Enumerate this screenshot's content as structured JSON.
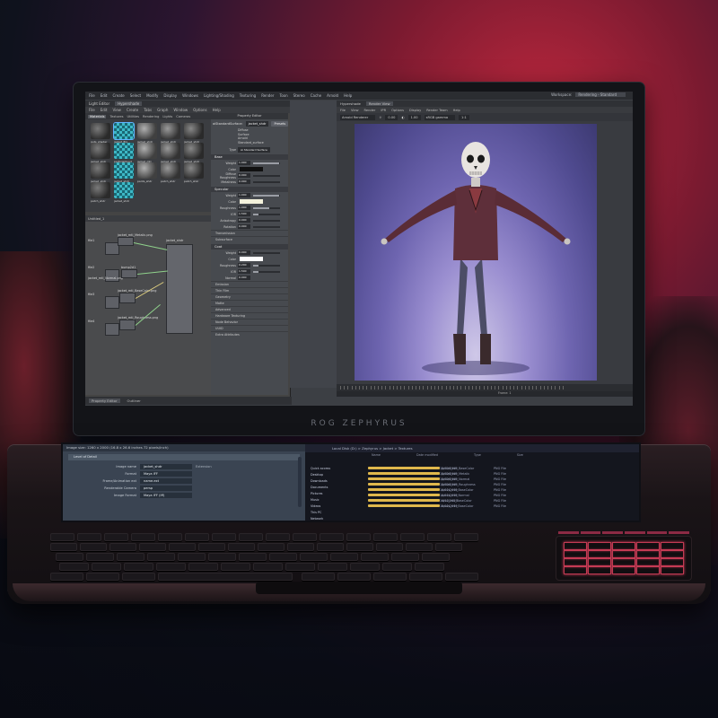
{
  "laptop": {
    "brand": "ROG ZEPHYRUS"
  },
  "maya": {
    "menu": [
      "File",
      "Edit",
      "Create",
      "Select",
      "Modify",
      "Display",
      "Windows",
      "Lighting/Shading",
      "Texturing",
      "Render",
      "Toon",
      "Stereo",
      "Cache",
      "Arnold",
      "Help"
    ],
    "workspace_label": "Workspace:",
    "workspace_value": "Rendering - Standard"
  },
  "hypershade": {
    "title_tabs": [
      "Light Editor",
      "Hypershade"
    ],
    "menu": [
      "File",
      "Edit",
      "View",
      "Create",
      "Tabs",
      "Graph",
      "Window",
      "Options",
      "Help"
    ],
    "browser_tabs": [
      "Materials",
      "Textures",
      "Utilities",
      "Rendering",
      "Lights",
      "Cameras"
    ],
    "swatches": [
      "guts_shader",
      "jacket_fbx",
      "jacket_shdr",
      "jacket_shdr",
      "jacket_shdr",
      "jacket_shdr",
      "particleCloud",
      "jacket_mtl",
      "jacket_shdr",
      "jacket_shdr",
      "jacket_shdr",
      "jacket_shdr",
      "pants_shdr",
      "patch_shdr",
      "patch_shdr",
      "patch_shdr",
      "jacket_shdr"
    ],
    "graph_tab": "Untitled_1",
    "node_labels": [
      "jacket_mtl_Metalic.png",
      "jacket_mtl_Normal.png",
      "bump2d1",
      "jacket_mtl_BaseColor.png",
      "jacket_mtl_Roughness.png",
      "jacket_shdr",
      "file1",
      "file2",
      "file3",
      "file4"
    ],
    "bottom_tabs": [
      "Property Editor",
      "Outliner"
    ]
  },
  "attribute_editor": {
    "title": "Property Editor",
    "node_type": "aiStandardSurface:",
    "node_name": "jacket_shdr",
    "presets": "Presets",
    "shader_list": [
      "Diffuse",
      "Surface",
      "Arnold",
      "Standard_surface"
    ],
    "type_label": "Type",
    "type_value": "Ai Standard Surface",
    "sections": [
      {
        "name": "Base",
        "rows": [
          {
            "label": "Weight",
            "value": "1.000",
            "fill": 0.95
          },
          {
            "label": "Color",
            "chip": "#111111"
          },
          {
            "label": "Diffuse Roughness",
            "value": "0.000",
            "fill": 0.0
          },
          {
            "label": "Metalness",
            "value": "0.000",
            "fill": 0.0
          }
        ]
      },
      {
        "name": "Specular",
        "rows": [
          {
            "label": "Weight",
            "value": "1.000",
            "fill": 0.95
          },
          {
            "label": "Color",
            "chip": "#f4f2dc"
          },
          {
            "label": "Roughness",
            "value": "1.000",
            "fill": 0.6
          },
          {
            "label": "IOR",
            "value": "1.500",
            "fill": 0.2
          },
          {
            "label": "Anisotropy",
            "value": "0.000",
            "fill": 0.0
          },
          {
            "label": "Rotation",
            "value": "0.000",
            "fill": 0.0
          }
        ]
      }
    ],
    "collapsed_a": [
      "Transmission",
      "Subsurface"
    ],
    "coat": {
      "name": "Coat",
      "rows": [
        {
          "label": "Weight",
          "value": "0.000",
          "fill": 0.0
        },
        {
          "label": "Color",
          "chip": "#ffffff"
        },
        {
          "label": "Roughness",
          "value": "0.200",
          "fill": 0.2
        },
        {
          "label": "IOR",
          "value": "1.500",
          "fill": 0.2
        },
        {
          "label": "Normal",
          "value": "0.000"
        }
      ]
    },
    "collapsed_b": [
      "Emission",
      "Thin Film",
      "Geometry",
      "Matte",
      "Advanced",
      "Hardware Texturing",
      "Node Behavior",
      "UUID",
      "Extra Attributes"
    ]
  },
  "render_view": {
    "tabs": [
      "Hypershade",
      "Render View"
    ],
    "menu": [
      "File",
      "View",
      "Render",
      "IPR",
      "Options",
      "Display",
      "Render Team",
      "Help"
    ],
    "renderer": "Arnold Renderer",
    "exposure": "0.00",
    "gamma": "1.00",
    "colorspace": "sRGB gamma",
    "size": "1:1",
    "frame_info": "Frame: 1"
  },
  "screenpad": {
    "left_title": "Image size: 1260 x 2000 (16.8 x 26.6 inches 72 pixels/inch)",
    "left_section": "Level of Detail",
    "rows": [
      {
        "label": "Image name",
        "value": "jacket_shdr",
        "check": "Extension"
      },
      {
        "label": "Format",
        "value": "Maya IFF"
      },
      {
        "label": "Frame/Animation ext",
        "value": "name.ext"
      },
      {
        "label": "Renderable Camera",
        "value": "persp"
      },
      {
        "label": "Image Format",
        "value": "Maya IFF (iff)"
      }
    ],
    "right_path": "Local Disk (D:) > Zephyrus > Jacket > Textures",
    "cols": [
      "Name",
      "Date modified",
      "Type",
      "Size"
    ],
    "sidebar": [
      "Quick access",
      "Desktop",
      "Downloads",
      "Documents",
      "Pictures",
      "Music",
      "Videos",
      "This PC",
      "Network"
    ],
    "files": [
      {
        "name": "jacket_mtl_BaseColor",
        "date": "10/12/2019",
        "type": "PNG File"
      },
      {
        "name": "jacket_mtl_Metalic",
        "date": "10/12/2019",
        "type": "PNG File"
      },
      {
        "name": "jacket_mtl_Normal",
        "date": "10/12/2019",
        "type": "PNG File"
      },
      {
        "name": "jacket_mtl_Roughness",
        "date": "10/12/2019",
        "type": "PNG File"
      },
      {
        "name": "pants_mtl_BaseColor",
        "date": "10/12/2019",
        "type": "PNG File"
      },
      {
        "name": "pants_mtl_Normal",
        "date": "10/12/2019",
        "type": "PNG File"
      },
      {
        "name": "skull_mtl_BaseColor",
        "date": "10/12/2019",
        "type": "PNG File"
      },
      {
        "name": "boots_mtl_BaseColor",
        "date": "10/12/2019",
        "type": "PNG File"
      }
    ]
  },
  "colors": {
    "accent_red": "#c13a52",
    "key_glow": "#c8a6ff"
  }
}
